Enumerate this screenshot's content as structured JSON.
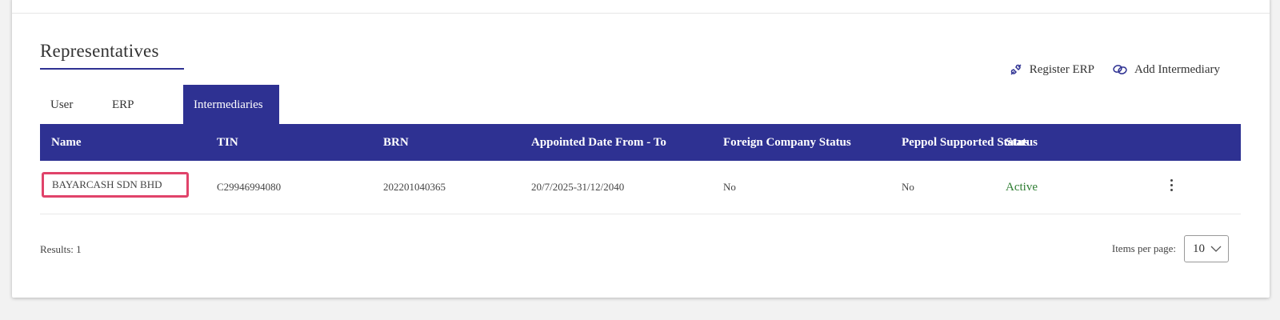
{
  "section": {
    "title": "Representatives"
  },
  "actions": {
    "register_erp": "Register ERP",
    "add_intermediary": "Add Intermediary"
  },
  "tabs": [
    {
      "label": "User",
      "active": false
    },
    {
      "label": "ERP",
      "active": false
    },
    {
      "label": "Intermediaries",
      "active": true
    }
  ],
  "table": {
    "columns": [
      "Name",
      "TIN",
      "BRN",
      "Appointed Date From - To",
      "Foreign Company Status",
      "Peppol Supported Status",
      "Status"
    ],
    "rows": [
      {
        "name": "BAYARCASH SDN BHD",
        "tin": "C29946994080",
        "brn": "202201040365",
        "appointed": "20/7/2025-31/12/2040",
        "foreign": "No",
        "peppol": "No",
        "status": "Active"
      }
    ]
  },
  "footer": {
    "results": "Results: 1",
    "items_per_page_label": "Items per page:",
    "items_per_page_value": "10"
  },
  "colors": {
    "brand": "#2e3192",
    "active_status": "#2e7d32",
    "highlight": "#e0436a"
  }
}
